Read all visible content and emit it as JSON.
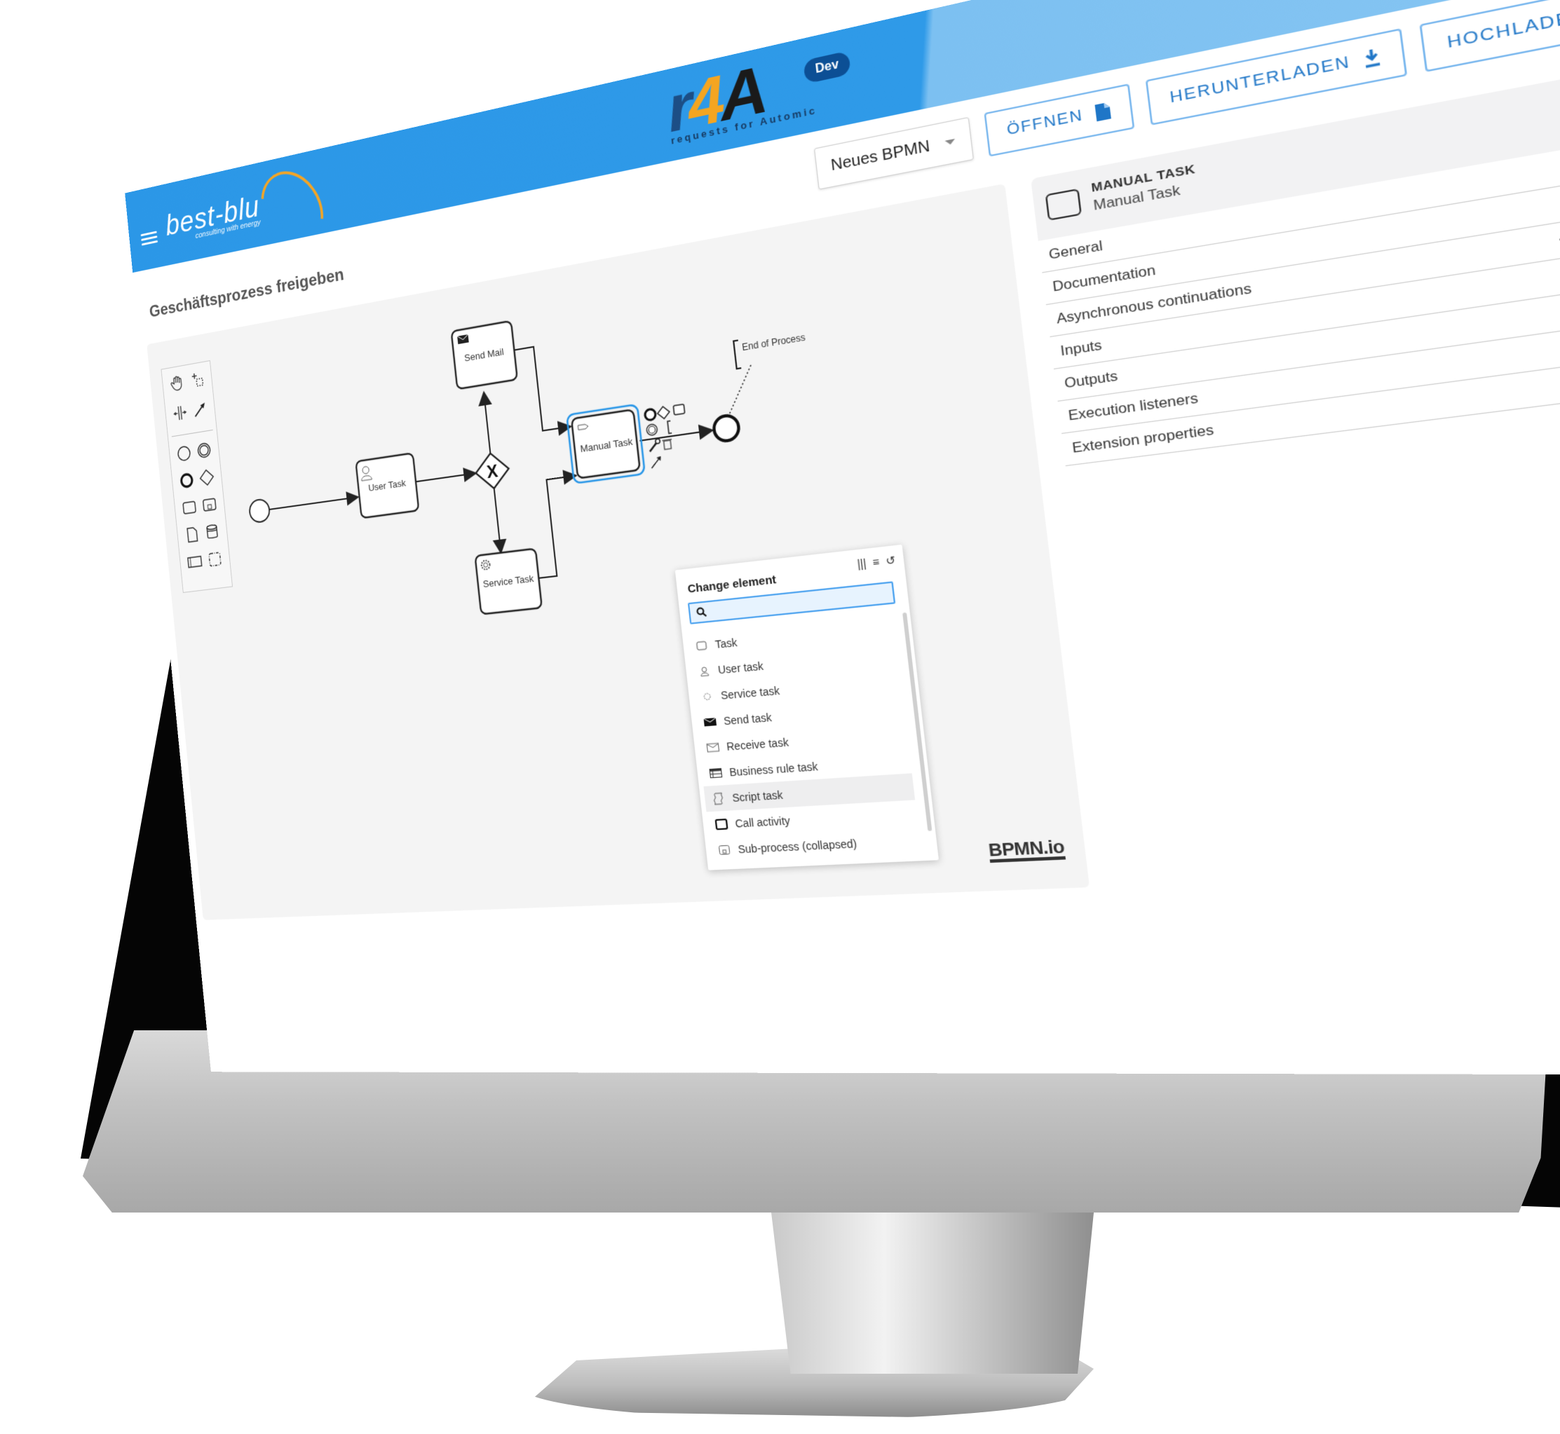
{
  "header": {
    "menu_icon": "hamburger-icon",
    "company_logo_word": "best-blu",
    "company_logo_tagline": "consulting with energy",
    "app_logo": {
      "r": "r",
      "four": "4",
      "a": "A",
      "subtitle": "requests for Automic"
    },
    "env_badge": "Dev",
    "icons": [
      "history-settings-icon",
      "globe-icon",
      "account-circle-icon"
    ],
    "colors": {
      "primary": "#2b97e7",
      "light": "#86c5f2",
      "accent_orange": "#f4a521",
      "badge": "#0c4f95"
    }
  },
  "toolbar": {
    "diagram_select": {
      "value": "Neues BPMN"
    },
    "open_label": "ÖFFNEN",
    "download_label": "HERUNTERLADEN",
    "upload_label": "HOCHLADEN"
  },
  "process": {
    "title": "Geschäftsprozess freigeben"
  },
  "palette": {
    "tools": [
      "hand-tool",
      "lasso-tool",
      "space-tool",
      "global-connect-tool"
    ],
    "elements": [
      "start-event",
      "intermediate-event",
      "end-event",
      "gateway",
      "task",
      "subprocess",
      "data-object",
      "data-store",
      "pool",
      "group"
    ]
  },
  "diagram": {
    "nodes": {
      "start": "",
      "user_task": "User Task",
      "gateway": "X",
      "send_mail": "Send Mail",
      "service_task": "Service Task",
      "manual_task": "Manual Task",
      "end": "",
      "annotation": "End of Process"
    },
    "watermark": "BPMN.io"
  },
  "change_element": {
    "title": "Change element",
    "header_icons": [
      "columns-icon",
      "list-icon",
      "refresh-icon"
    ],
    "search_placeholder": "",
    "items": [
      {
        "label": "Task",
        "icon": "task-icon"
      },
      {
        "label": "User task",
        "icon": "user-icon"
      },
      {
        "label": "Service task",
        "icon": "gear-icon"
      },
      {
        "label": "Send task",
        "icon": "envelope-filled-icon"
      },
      {
        "label": "Receive task",
        "icon": "envelope-outline-icon"
      },
      {
        "label": "Business rule task",
        "icon": "table-icon"
      },
      {
        "label": "Script task",
        "icon": "script-icon",
        "highlighted": true
      },
      {
        "label": "Call activity",
        "icon": "call-activity-icon"
      },
      {
        "label": "Sub-process (collapsed)",
        "icon": "subprocess-icon"
      }
    ]
  },
  "properties": {
    "element_kind": "MANUAL TASK",
    "element_name": "Manual Task",
    "groups": [
      {
        "label": "General",
        "action": "chevron"
      },
      {
        "label": "Documentation",
        "action": "chevron"
      },
      {
        "label": "Asynchronous continuations",
        "action": "plus"
      },
      {
        "label": "Inputs",
        "action": "plus"
      },
      {
        "label": "Outputs",
        "action": "plus"
      },
      {
        "label": "Execution listeners",
        "action": "plus"
      },
      {
        "label": "Extension properties",
        "action": ""
      }
    ]
  }
}
